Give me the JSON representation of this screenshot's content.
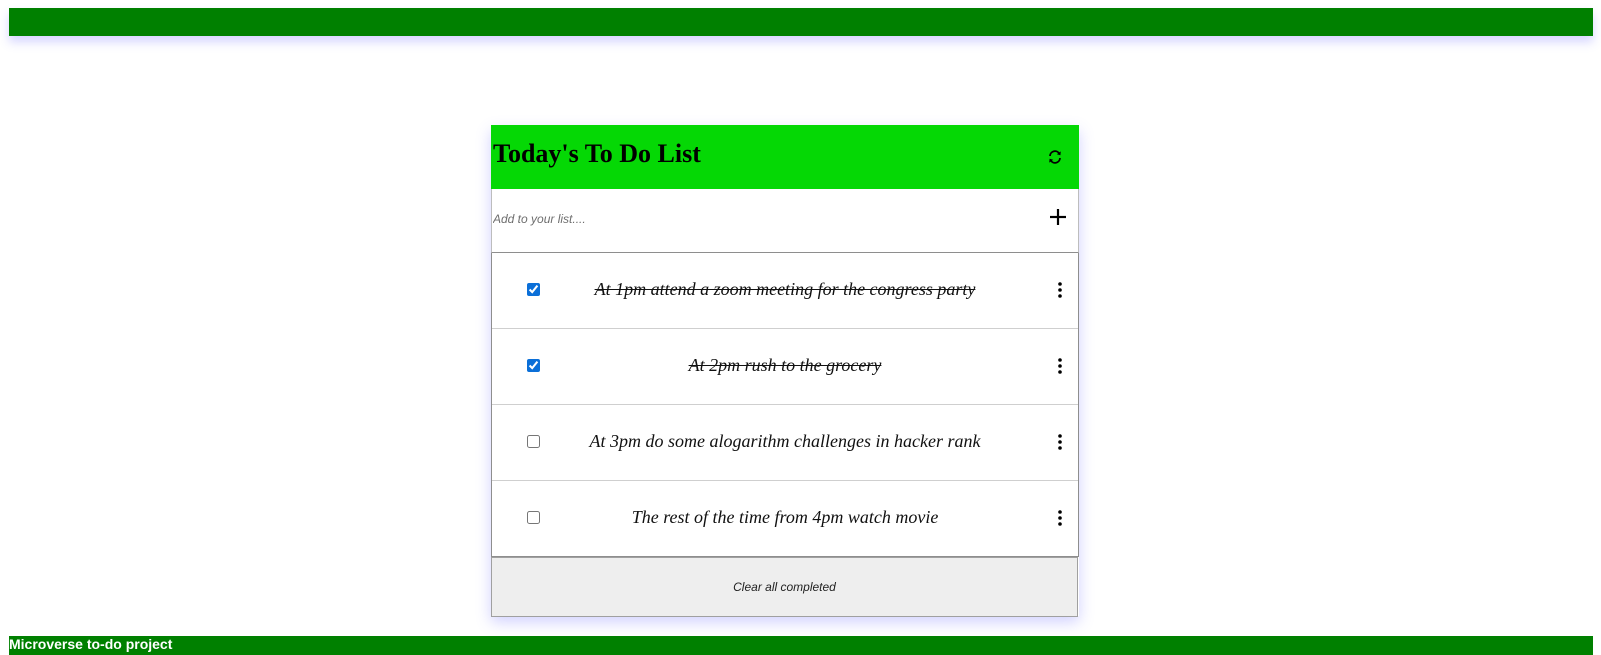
{
  "todo": {
    "title": "Today's To Do List",
    "refresh_icon": "refresh-icon",
    "add_placeholder": "Add to your list....",
    "add_icon": "plus-icon",
    "items": [
      {
        "text": "At 1pm attend a zoom meeting for the congress party",
        "completed": true,
        "menu_icon": "kebab-menu-icon"
      },
      {
        "text": "At 2pm rush to the grocery",
        "completed": true,
        "menu_icon": "kebab-menu-icon"
      },
      {
        "text": "At 3pm do some alogarithm challenges in hacker rank",
        "completed": false,
        "menu_icon": "kebab-menu-icon"
      },
      {
        "text": "The rest of the time from 4pm watch movie",
        "completed": false,
        "menu_icon": "kebab-menu-icon"
      }
    ],
    "clear_label": "Clear all completed"
  },
  "footer": {
    "text": "Microverse to-do project"
  },
  "colors": {
    "top_bar": "#008000",
    "header_bg": "#05d805",
    "checkbox_accent": "#0b6fd8",
    "footer_bg": "#008000"
  }
}
